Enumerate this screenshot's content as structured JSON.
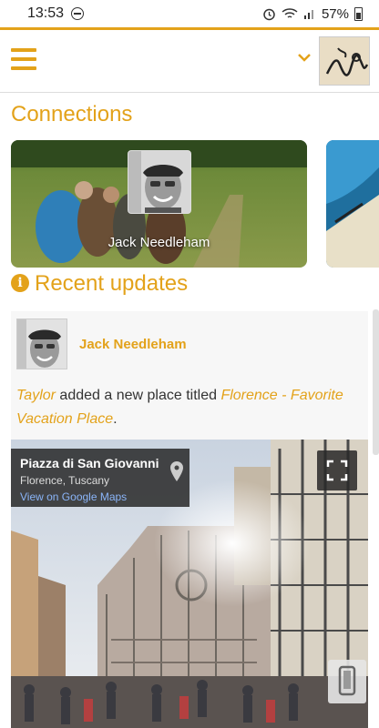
{
  "status": {
    "time": "13:53",
    "battery": "57%"
  },
  "nav": {
    "title": "Connections"
  },
  "connections": [
    {
      "name": "Jack Needleham"
    }
  ],
  "recent": {
    "title": "Recent updates",
    "item": {
      "author": "Jack Needleham",
      "actor": "Taylor",
      "text_mid": " added a new place titled ",
      "place": "Florence - Favorite Vacation Place",
      "text_end": "."
    }
  },
  "streetview": {
    "title": "Piazza di San Giovanni",
    "subtitle": "Florence, Tuscany",
    "link": "View on Google Maps"
  },
  "colors": {
    "accent": "#e3a21a"
  }
}
